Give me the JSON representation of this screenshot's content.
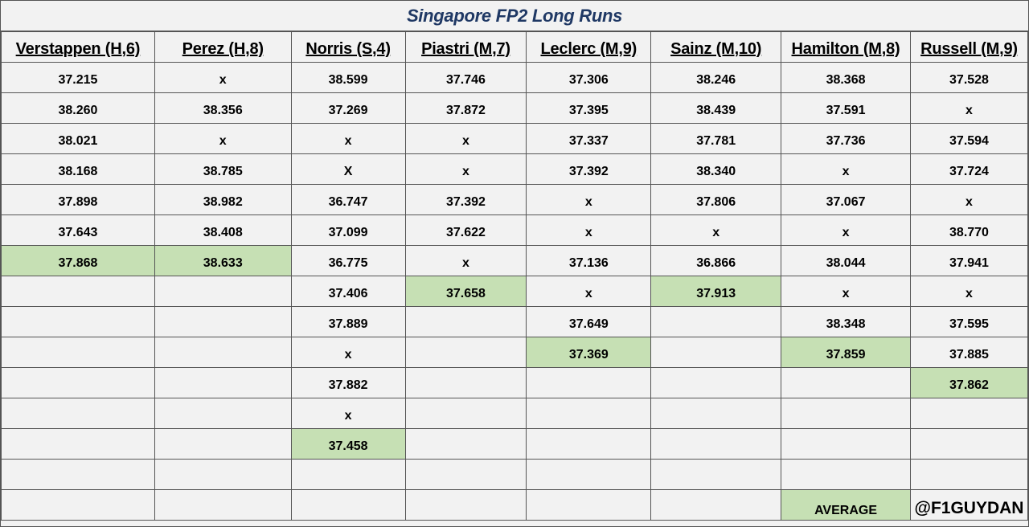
{
  "chart_data": {
    "type": "table",
    "title": "Singapore FP2 Long Runs",
    "columns": [
      "Verstappen (H,6)",
      "Perez (H,8)",
      "Norris (S,4)",
      "Piastri (M,7)",
      "Leclerc (M,9)",
      "Sainz (M,10)",
      "Hamilton (M,8)",
      "Russell (M,9)"
    ],
    "rows": [
      [
        "37.215",
        "x",
        "38.599",
        "37.746",
        "37.306",
        "38.246",
        "38.368",
        "37.528"
      ],
      [
        "38.260",
        "38.356",
        "37.269",
        "37.872",
        "37.395",
        "38.439",
        "37.591",
        "x"
      ],
      [
        "38.021",
        "x",
        "x",
        "x",
        "37.337",
        "37.781",
        "37.736",
        "37.594"
      ],
      [
        "38.168",
        "38.785",
        "X",
        "x",
        "37.392",
        "38.340",
        "x",
        "37.724"
      ],
      [
        "37.898",
        "38.982",
        "36.747",
        "37.392",
        "x",
        "37.806",
        "37.067",
        "x"
      ],
      [
        "37.643",
        "38.408",
        "37.099",
        "37.622",
        "x",
        "x",
        "x",
        "38.770"
      ],
      [
        "37.868",
        "38.633",
        "36.775",
        "x",
        "37.136",
        "36.866",
        "38.044",
        "37.941"
      ],
      [
        "",
        "",
        "37.406",
        "37.658",
        "x",
        "37.913",
        "x",
        "x"
      ],
      [
        "",
        "",
        "37.889",
        "",
        "37.649",
        "",
        "38.348",
        "37.595"
      ],
      [
        "",
        "",
        "x",
        "",
        "37.369",
        "",
        "37.859",
        "37.885"
      ],
      [
        "",
        "",
        "37.882",
        "",
        "",
        "",
        "",
        "37.862"
      ],
      [
        "",
        "",
        "x",
        "",
        "",
        "",
        "",
        ""
      ],
      [
        "",
        "",
        "37.458",
        "",
        "",
        "",
        "",
        ""
      ],
      [
        "",
        "",
        "",
        "",
        "",
        "",
        "",
        ""
      ],
      [
        "",
        "",
        "",
        "",
        "",
        "",
        "AVERAGE",
        "@F1GUYDAN"
      ]
    ],
    "highlighted_average_row_index": [
      6,
      6,
      12,
      7,
      9,
      7,
      9,
      10
    ],
    "highlighted_label_cell": "AVERAGE",
    "highlight_color": "#c6e0b4",
    "title_color": "#1f3864",
    "grid": true
  }
}
